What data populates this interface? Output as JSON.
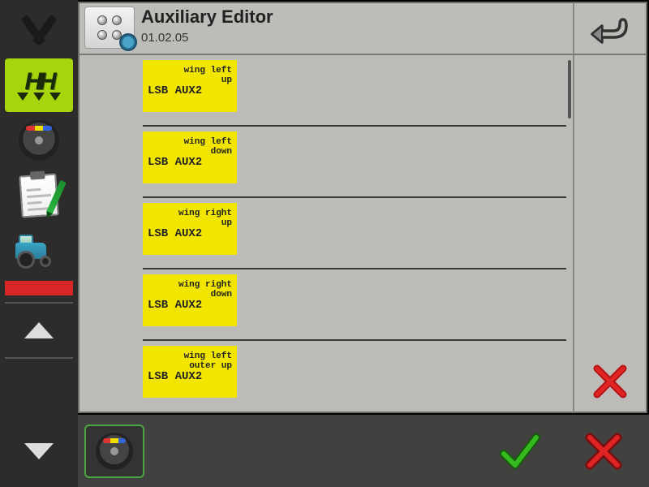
{
  "header": {
    "title": "Auxiliary Editor",
    "version": "01.02.05"
  },
  "list": [
    {
      "function": "wing left\nup",
      "source": "LSB AUX2"
    },
    {
      "function": "wing left\ndown",
      "source": "LSB AUX2"
    },
    {
      "function": "wing right\nup",
      "source": "LSB AUX2"
    },
    {
      "function": "wing right\ndown",
      "source": "LSB AUX2"
    },
    {
      "function": "wing left\nouter up",
      "source": "LSB AUX2"
    }
  ],
  "sidebar": {
    "active_index": 1
  },
  "colors": {
    "accent": "#a8d40b",
    "tag": "#f2e600",
    "ok": "#33a01f",
    "cancel": "#cc1f1f"
  }
}
